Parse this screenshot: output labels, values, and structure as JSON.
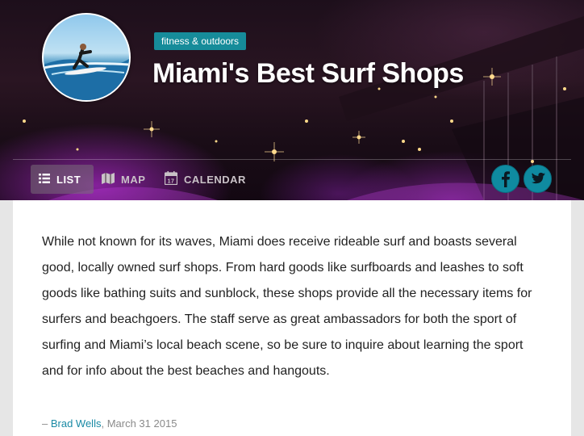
{
  "header": {
    "category": "fitness & outdoors",
    "title": "Miami's Best Surf Shops"
  },
  "nav": {
    "tabs": [
      {
        "label": "LIST",
        "icon": "list-icon",
        "active": true
      },
      {
        "label": "MAP",
        "icon": "map-icon",
        "active": false
      },
      {
        "label": "CALENDAR",
        "icon": "calendar-icon",
        "active": false
      }
    ],
    "calendar_icon_day": "17"
  },
  "share": {
    "facebook_icon": "facebook-icon",
    "twitter_icon": "twitter-icon"
  },
  "article": {
    "intro": "While not known for its waves, Miami does receive rideable surf and boasts several good, locally owned surf shops. From hard goods like surfboards and leashes to soft goods like bathing suits and sunblock, these shops provide all the necessary items for surfers and beachgoers. The staff serve as great ambassadors for both the sport of surfing and Miami’s local beach scene, so be sure to inquire about learning the sport and for info about the best beaches and hangouts.",
    "byline_prefix": "– ",
    "author": "Brad Wells",
    "byline_separator": ", ",
    "date": "March 31 2015"
  },
  "colors": {
    "accent": "#168c9a",
    "link": "#1a8aa5",
    "social": "#0f8aa0"
  }
}
